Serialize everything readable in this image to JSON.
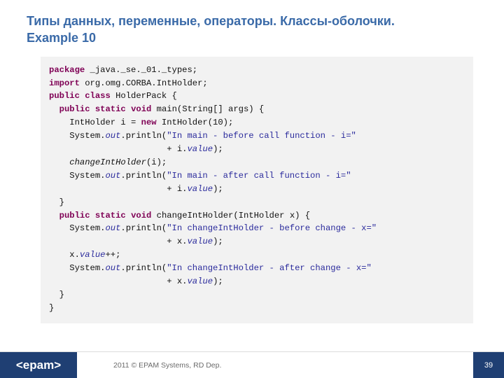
{
  "header": {
    "title_line1": "Типы данных, переменные, операторы. Классы-оболочки.",
    "title_line2": "Example 10"
  },
  "code": {
    "kw_package": "package",
    "pkg_rest": " _java._se._01._types;",
    "kw_import": "import",
    "import_rest": " org.omg.CORBA.IntHolder;",
    "kw_public": "public",
    "kw_class": "class",
    "class_rest": " HolderPack {",
    "kw_static": "static",
    "kw_void": "void",
    "main_sig": " main(String[] args) {",
    "intholder_a": "    IntHolder i = ",
    "kw_new": "new",
    "intholder_b": " IntHolder(10);",
    "sys": "    System.",
    "out": "out",
    "print_open": ".println(",
    "str_main_before": "\"In main - before call function - i=\"",
    "plus_indent": "                       + i.",
    "value": "value",
    "close_paren": ");",
    "call_change": "changeIntHolder",
    "call_change_args": "(i);",
    "str_main_after": "\"In main - after call function - i=\"",
    "brace_close_inner": "  }",
    "change_sig": " changeIntHolder(IntHolder x) {",
    "str_ch_before": "\"In changeIntHolder - before change - x=\"",
    "plus_indent_x": "                       + x.",
    "x_inc": "    x.",
    "x_inc_tail": "++;",
    "str_ch_after": "\"In changeIntHolder - after change - x=\"",
    "brace_close_outer": "}"
  },
  "footer": {
    "logo": "<epam>",
    "copyright": "2011 © EPAM Systems, RD Dep.",
    "page": "39"
  }
}
